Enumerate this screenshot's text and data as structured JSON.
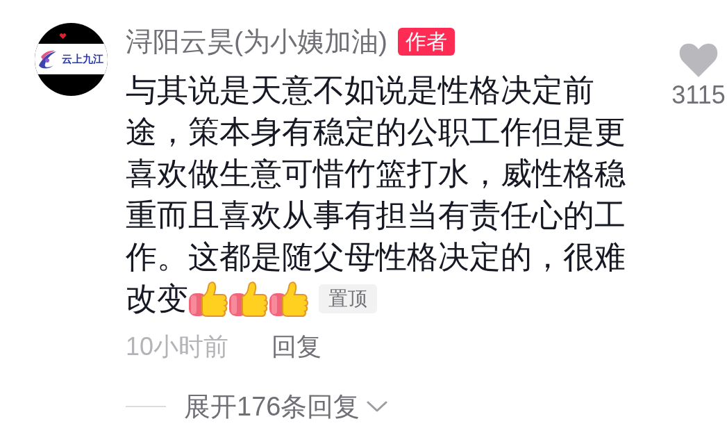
{
  "comment": {
    "avatar": {
      "logo_text": "云上九江"
    },
    "author": {
      "name": "浔阳云昊(为小姨加油)",
      "badge": "作者"
    },
    "content": [
      "与其说是天意不如说是性格决定前途，策本身有稳定的公职工作但是更喜欢做生意可惜竹篮打水，威性格稳重而且喜欢从事有担当有责任心的工作。这都是随父母性格决定的，很难",
      "改变"
    ],
    "emojis": [
      {
        "kind": "thumbs_up"
      },
      {
        "kind": "thumbs_up"
      },
      {
        "kind": "thumbs_up"
      }
    ],
    "tag": "置顶",
    "time": "10小时前",
    "reply_label": "回复",
    "likes": {
      "liked": false,
      "count": "3115"
    }
  },
  "replies_toggle": {
    "label": "展开176条回复",
    "expanded": false
  }
}
